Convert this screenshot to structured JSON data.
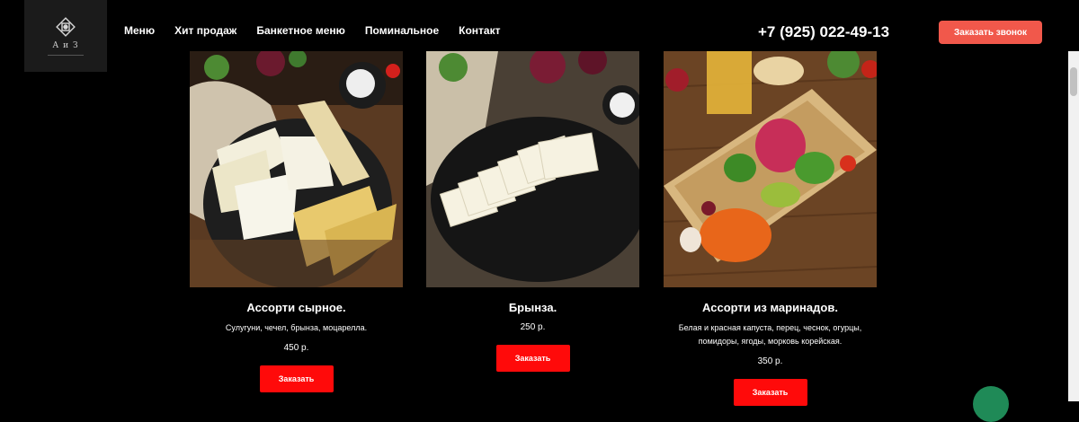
{
  "header": {
    "logo_text": "А и З",
    "nav": [
      "Меню",
      "Хит продаж",
      "Банкетное меню",
      "Поминальное",
      "Контакт"
    ],
    "phone": "+7 (925) 022-49-13",
    "callback_label": "Заказать звонок"
  },
  "products": [
    {
      "title": "Ассорти сырное.",
      "desc": "Сулугуни, чечел, брынза, моцарелла.",
      "price": "450 р.",
      "order_label": "Заказать"
    },
    {
      "title": "Брынза.",
      "desc": "",
      "price": "250 р.",
      "order_label": "Заказать"
    },
    {
      "title": "Ассорти из маринадов.",
      "desc": "Белая и красная капуста, перец, чеснок, огурцы, помидоры, ягоды, морковь корейская.",
      "price": "350 р.",
      "order_label": "Заказать"
    }
  ],
  "colors": {
    "accent": "#f1584b",
    "order_button": "#ff0a0a",
    "background": "#000000"
  }
}
